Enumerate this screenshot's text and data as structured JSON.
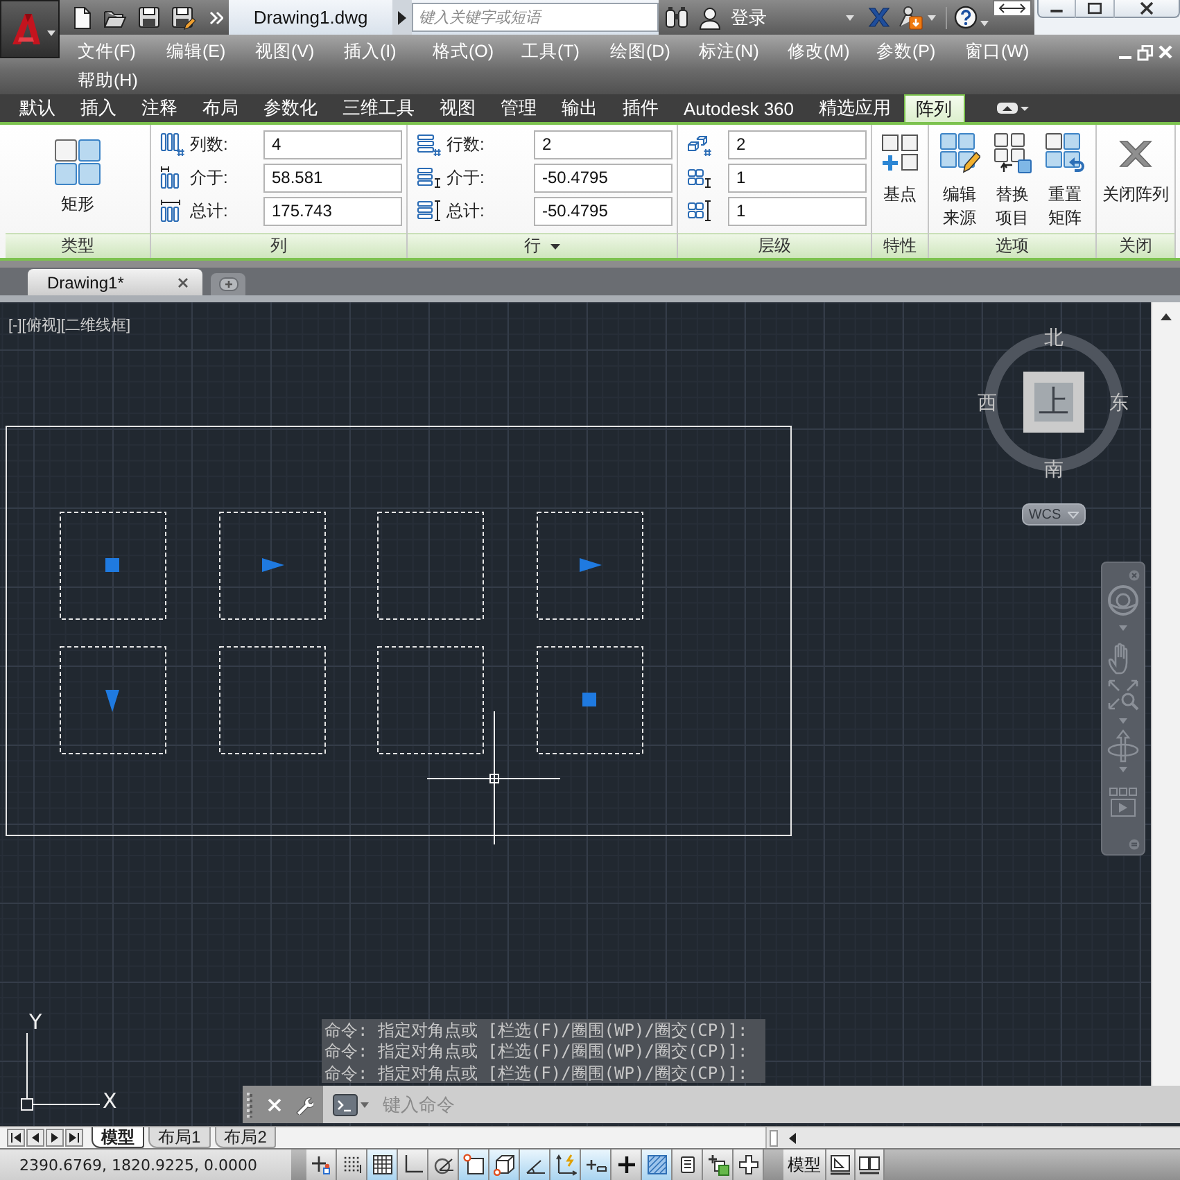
{
  "title_bar": {
    "title": "Drawing1.dwg",
    "search": {
      "placeholder": "键入关键字或短语"
    },
    "sign_in": "登录"
  },
  "menu_bar": {
    "items": [
      "文件(F)",
      "编辑(E)",
      "视图(V)",
      "插入(I)",
      "格式(O)",
      "工具(T)",
      "绘图(D)",
      "标注(N)",
      "修改(M)",
      "参数(P)",
      "窗口(W)",
      "帮助(H)"
    ]
  },
  "ribbon": {
    "tabs": [
      {
        "label": "默认",
        "selected": false
      },
      {
        "label": "插入",
        "selected": false
      },
      {
        "label": "注释",
        "selected": false
      },
      {
        "label": "布局",
        "selected": false
      },
      {
        "label": "参数化",
        "selected": false
      },
      {
        "label": "三维工具",
        "selected": false
      },
      {
        "label": "视图",
        "selected": false
      },
      {
        "label": "管理",
        "selected": false
      },
      {
        "label": "输出",
        "selected": false
      },
      {
        "label": "插件",
        "selected": false
      },
      {
        "label": "Autodesk 360",
        "selected": false
      },
      {
        "label": "精选应用",
        "selected": false
      },
      {
        "label": "阵列",
        "selected": true
      }
    ],
    "panels": [
      {
        "kind": "type",
        "title": "类型",
        "buttons": [
          "矩形"
        ]
      },
      {
        "kind": "columns",
        "title": "列",
        "fields": [
          {
            "label": "列数:",
            "value": "4"
          },
          {
            "label": "介于:",
            "value": "58.581"
          },
          {
            "label": "总计:",
            "value": "175.743"
          }
        ]
      },
      {
        "kind": "rows",
        "title": "行",
        "expandable": true,
        "fields": [
          {
            "label": "行数:",
            "value": "2"
          },
          {
            "label": "介于:",
            "value": "-50.4795"
          },
          {
            "label": "总计:",
            "value": "-50.4795"
          }
        ]
      },
      {
        "kind": "levels",
        "title": "层级",
        "fields": [
          {
            "value": "2"
          },
          {
            "value": "1"
          },
          {
            "value": "1"
          }
        ]
      },
      {
        "kind": "properties",
        "title": "特性",
        "buttons": [
          "基点"
        ]
      },
      {
        "kind": "options",
        "title": "选项",
        "buttons": [
          "编辑来源",
          "替换项目",
          "重置矩阵"
        ]
      },
      {
        "kind": "close",
        "title": "关闭",
        "buttons": [
          "关闭阵列"
        ]
      }
    ]
  },
  "file_tabs": [
    {
      "label": "Drawing1*",
      "selected": true
    }
  ],
  "viewport": {
    "controls": [
      "[-]",
      "[俯视]",
      "[二维线框]"
    ]
  },
  "array": {
    "rows": [
      {
        "items": [
          {
            "kind": "square_grip"
          },
          {
            "kind": "right_triangle_grip"
          },
          {
            "kind": "plain"
          },
          {
            "kind": "right_triangle_grip"
          }
        ]
      },
      {
        "items": [
          {
            "kind": "down_triangle_grip"
          },
          {
            "kind": "plain"
          },
          {
            "kind": "plain"
          },
          {
            "kind": "square_grip"
          }
        ]
      }
    ]
  },
  "ucs_icon": {
    "x_label": "X",
    "y_label": "Y"
  },
  "viewcube": {
    "north": "北",
    "south": "南",
    "west": "西",
    "east": "东",
    "face": "上",
    "coordinate_system": "WCS"
  },
  "command_line": {
    "history": [
      "命令: 指定对角点或 [栏选(F)/圈围(WP)/圈交(CP)]:",
      "命令: 指定对角点或 [栏选(F)/圈围(WP)/圈交(CP)]:",
      "命令: 指定对角点或 [栏选(F)/圈围(WP)/圈交(CP)]:"
    ],
    "input": {
      "placeholder": "键入命令"
    }
  },
  "layout_tabs": [
    {
      "label": "模型",
      "selected": true
    },
    {
      "label": "布局1",
      "selected": false
    },
    {
      "label": "布局2",
      "selected": false
    }
  ],
  "status_bar": {
    "coordinates": "2390.6769, 1820.9225, 0.0000",
    "toggles": [
      {
        "kind": "infer",
        "on": false
      },
      {
        "kind": "snap",
        "on": false
      },
      {
        "kind": "grid",
        "on": true
      },
      {
        "kind": "ortho",
        "on": false
      },
      {
        "kind": "polar",
        "on": false
      },
      {
        "kind": "osnap",
        "on": true
      },
      {
        "kind": "osnap3d",
        "on": true
      },
      {
        "kind": "otrack",
        "on": true
      },
      {
        "kind": "ducs",
        "on": true
      },
      {
        "kind": "dyn",
        "on": true
      },
      {
        "kind": "lwt",
        "on": false
      },
      {
        "kind": "transparency",
        "on": true
      },
      {
        "kind": "quick_properties",
        "on": false
      },
      {
        "kind": "selection_cycling",
        "on": false
      },
      {
        "kind": "annotation_monitor",
        "on": false
      }
    ],
    "model": "模型"
  }
}
